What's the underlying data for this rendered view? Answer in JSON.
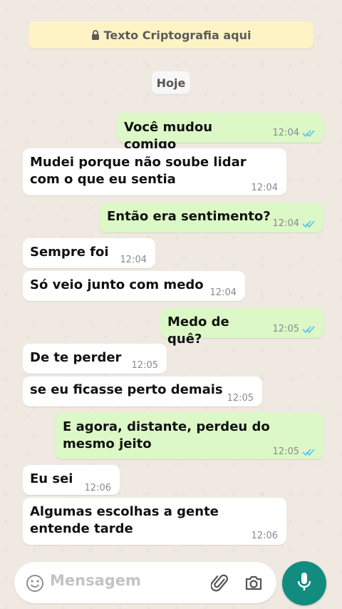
{
  "banner": {
    "text": "Texto Criptografia aqui",
    "icon": "lock-icon"
  },
  "date_chip": "Hoje",
  "messages": [
    {
      "direction": "out",
      "text": "Você mudou comigo",
      "time": "12:04",
      "status": "read"
    },
    {
      "direction": "in",
      "text": "Mudei porque não soube lidar com o que eu sentia",
      "time": "12:04"
    },
    {
      "direction": "out",
      "text": "Então era sentimento?",
      "time": "12:04",
      "status": "read"
    },
    {
      "direction": "in",
      "text": "Sempre foi",
      "time": "12:04"
    },
    {
      "direction": "in",
      "text": "Só veio junto com medo",
      "time": "12:04"
    },
    {
      "direction": "out",
      "text": "Medo de quê?",
      "time": "12:05",
      "status": "read"
    },
    {
      "direction": "in",
      "text": "De te perder",
      "time": "12:05"
    },
    {
      "direction": "in",
      "text": "se eu ficasse perto demais",
      "time": "12:05"
    },
    {
      "direction": "out",
      "text": "E agora, distante, perdeu do mesmo jeito",
      "time": "12:05",
      "status": "read"
    },
    {
      "direction": "in",
      "text": "Eu sei",
      "time": "12:06"
    },
    {
      "direction": "in",
      "text": "Algumas escolhas a gente entende tarde",
      "time": "12:06"
    }
  ],
  "composer": {
    "placeholder": "Mensagem",
    "emoji_icon": "emoji-icon",
    "attach_icon": "paperclip-icon",
    "camera_icon": "camera-icon",
    "mic_icon": "microphone-icon"
  },
  "colors": {
    "outgoing_bubble": "#dcf8c6",
    "incoming_bubble": "#ffffff",
    "banner": "#fdf3c4",
    "accent": "#128c7e",
    "read_ticks": "#4fc3f7"
  }
}
